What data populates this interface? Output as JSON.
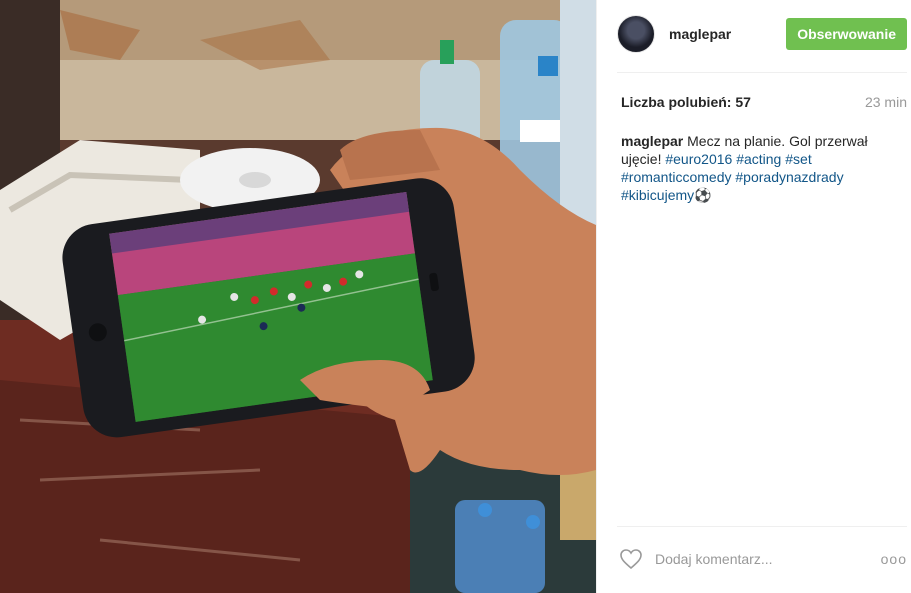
{
  "post": {
    "username": "maglepar",
    "follow_label": "Obserwowanie",
    "likes_text": "Liczba polubień: 57",
    "time_ago": "23 min",
    "caption": {
      "username": "maglepar",
      "text": " Mecz na planie. Gol przerwał ujęcie! ",
      "hashtags": [
        "#euro2016",
        "#acting",
        "#set",
        "#romanticcomedy",
        "#poradynazdrady",
        "#kibicujemy⚽"
      ]
    },
    "comment_placeholder": "Dodaj komentarz...",
    "more_label": "ooo"
  },
  "colors": {
    "follow_bg": "#70c050",
    "hashtag": "#125688",
    "muted": "#999999"
  },
  "icons": {
    "heart": "heart-icon",
    "more": "more-options-icon"
  }
}
